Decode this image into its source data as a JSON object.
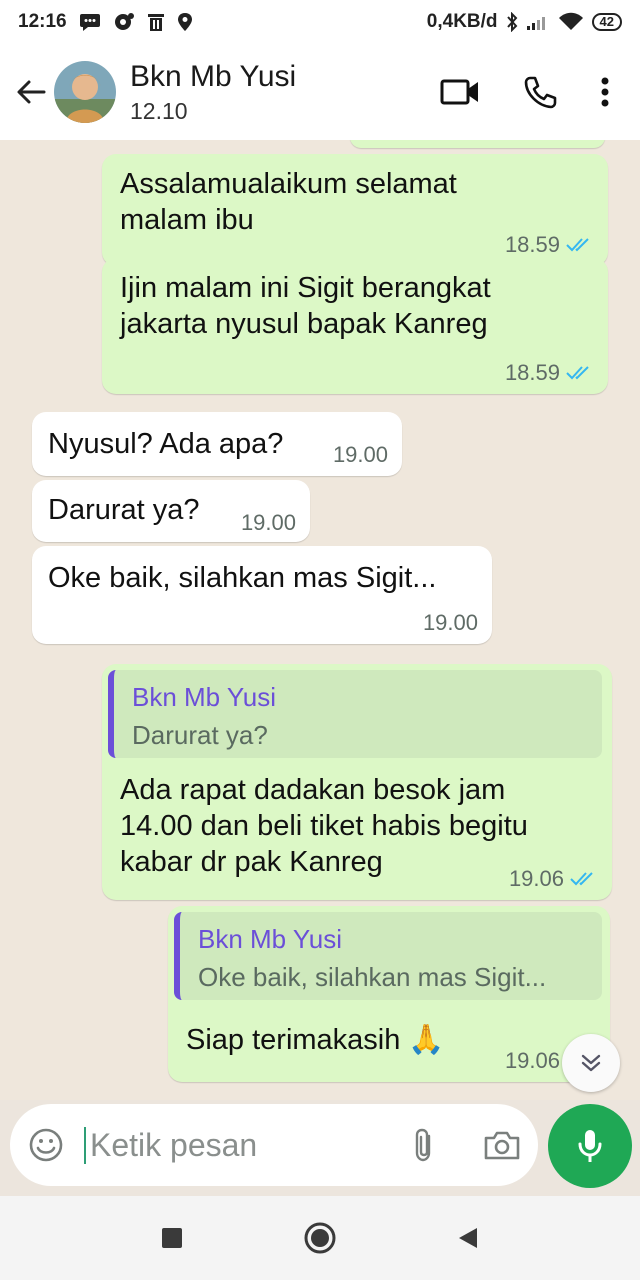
{
  "status_bar": {
    "time": "12:16",
    "network_speed": "0,4KB/d",
    "battery": "42",
    "icons": [
      "chat-icon",
      "notification-icon",
      "trash-icon",
      "location-icon",
      "bluetooth-icon",
      "signal-icon",
      "wifi-icon",
      "battery-icon"
    ]
  },
  "header": {
    "contact_name": "Bkn Mb Yusi",
    "subtitle": "12.10",
    "icons": [
      "back-arrow-icon",
      "video-call-icon",
      "phone-icon",
      "more-icon"
    ]
  },
  "messages": [
    {
      "direction": "out",
      "text_lines": [
        "Assalamualaikum selamat",
        "malam ibu"
      ],
      "time": "18.59",
      "status": "read"
    },
    {
      "direction": "out",
      "text_lines": [
        "Ijin malam ini Sigit berangkat",
        "jakarta nyusul bapak Kanreg"
      ],
      "time": "18.59",
      "status": "read"
    },
    {
      "direction": "in",
      "text_lines": [
        "Nyusul? Ada apa?"
      ],
      "time": "19.00"
    },
    {
      "direction": "in",
      "text_lines": [
        "Darurat ya?"
      ],
      "time": "19.00"
    },
    {
      "direction": "in",
      "text_lines": [
        "Oke baik, silahkan mas Sigit..."
      ],
      "time": "19.00"
    },
    {
      "direction": "out",
      "quote": {
        "name": "Bkn Mb Yusi",
        "text": "Darurat ya?"
      },
      "text_lines": [
        "Ada rapat dadakan besok jam",
        "14.00 dan beli tiket habis begitu",
        "kabar dr pak Kanreg"
      ],
      "time": "19.06",
      "status": "read"
    },
    {
      "direction": "out",
      "quote": {
        "name": "Bkn Mb Yusi",
        "text": "Oke baik, silahkan mas Sigit..."
      },
      "text_lines": [
        "Siap terimakasih 🙏"
      ],
      "time": "19.06",
      "status": "read"
    }
  ],
  "composer": {
    "placeholder": "Ketik pesan"
  },
  "colors": {
    "outgoing_bubble": "#dcf8c6",
    "incoming_bubble": "#ffffff",
    "quote_accent": "#6b4fd8",
    "read_ticks": "#34b7f1",
    "mic_button": "#1fa855",
    "chat_background": "#efe7dc"
  }
}
